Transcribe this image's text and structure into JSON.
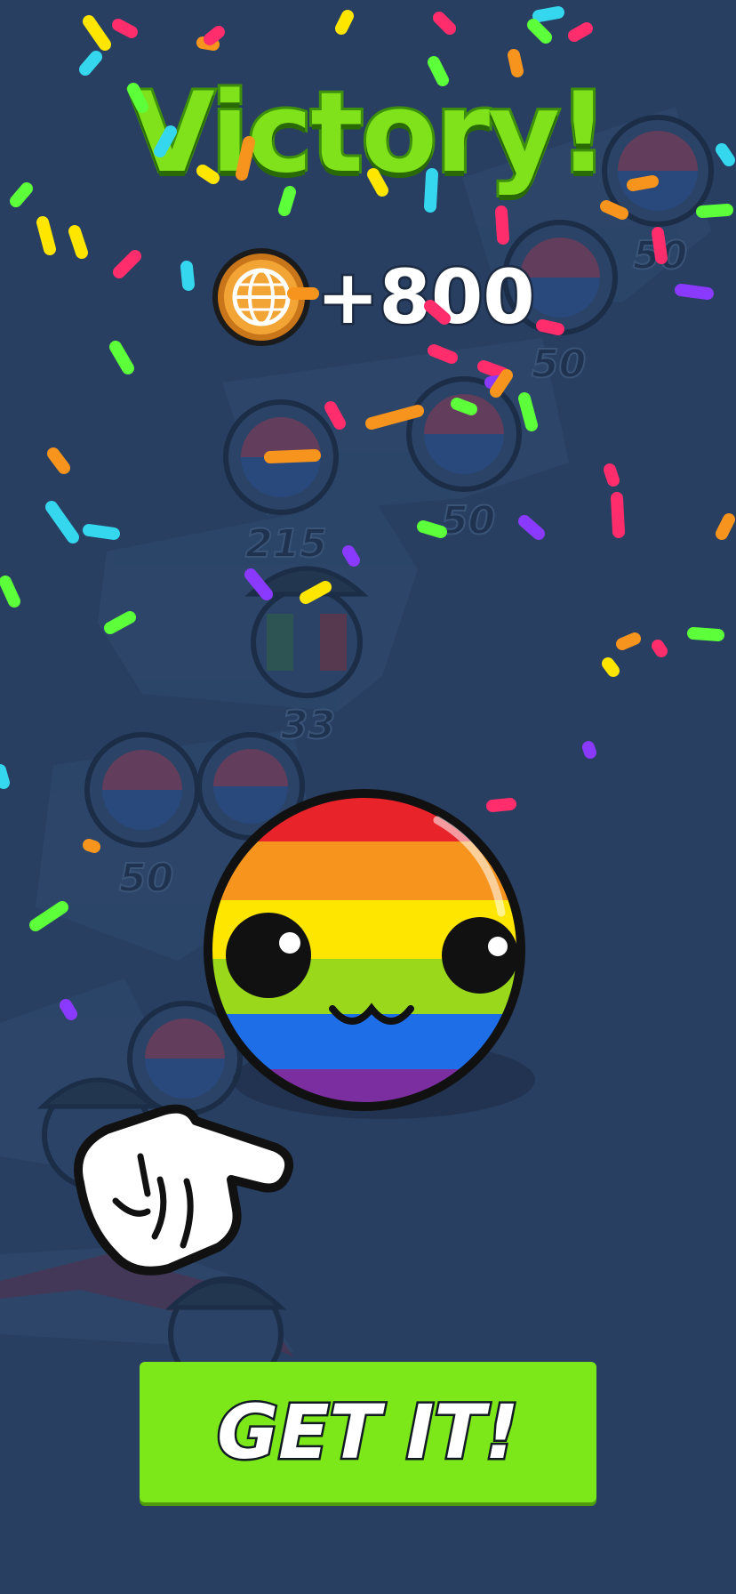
{
  "screen": {
    "title": "Victory!",
    "reward": {
      "amount": "+800",
      "currency_icon": "globe-coin-icon"
    },
    "button_label": "GET IT!",
    "unlocked_character": "rainbow-ball-character",
    "pointer": "pointing-hand-icon"
  },
  "map": {
    "territories": [
      {
        "label": "50",
        "character": "korea-ball-icon"
      },
      {
        "label": "50",
        "character": "korea-ball-icon"
      },
      {
        "label": "215",
        "character": "korea-ball-icon"
      },
      {
        "label": "50",
        "character": "korea-ball-icon"
      },
      {
        "label": "33",
        "character": "police-ball-icon"
      },
      {
        "label": "50",
        "character": "korea-ball-icon"
      }
    ]
  },
  "colors": {
    "background": "#283f62",
    "title_green": "#7fe21a",
    "button_green": "#7ce819",
    "rainbow": [
      "#e8232a",
      "#f7941d",
      "#ffe600",
      "#9ad81b",
      "#1e6ee8",
      "#7b2ea0"
    ]
  }
}
